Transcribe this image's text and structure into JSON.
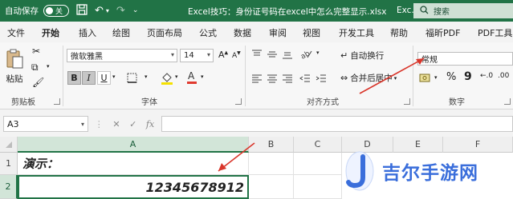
{
  "titlebar": {
    "autosave_label": "自动保存",
    "toggle_text": "关",
    "doc_title": "Excel技巧：身份证号码在excel中怎么完整显示.xlsx",
    "doc_title_tail": "Exc...",
    "search_placeholder": "搜索"
  },
  "menu": {
    "tabs": [
      "文件",
      "开始",
      "插入",
      "绘图",
      "页面布局",
      "公式",
      "数据",
      "审阅",
      "视图",
      "开发工具",
      "帮助",
      "福昕PDF",
      "PDF工具"
    ],
    "active": "开始"
  },
  "ribbon": {
    "paste_label": "粘贴",
    "clipboard_label": "剪贴板",
    "font_name": "微软雅黑",
    "font_size": "14",
    "font_group_label": "字体",
    "bold": "B",
    "italic": "I",
    "underline": "U",
    "wrap_text": "自动换行",
    "merge_center": "合并后居中",
    "align_group_label": "对齐方式",
    "number_format": "常规",
    "number_group_label": "数字",
    "percent": "%",
    "comma": "9"
  },
  "formulabar": {
    "cell_ref": "A3",
    "formula": ""
  },
  "grid": {
    "columns": [
      "A",
      "B",
      "C",
      "D",
      "E",
      "F"
    ],
    "rows": [
      "1",
      "2"
    ],
    "a1": "演示：",
    "a2": "12345678912"
  },
  "watermark": {
    "text": "吉尔手游网"
  },
  "colors": {
    "excel_green": "#217346",
    "annotation_arrow": "#d9362b",
    "watermark_blue": "#3a6edb"
  }
}
